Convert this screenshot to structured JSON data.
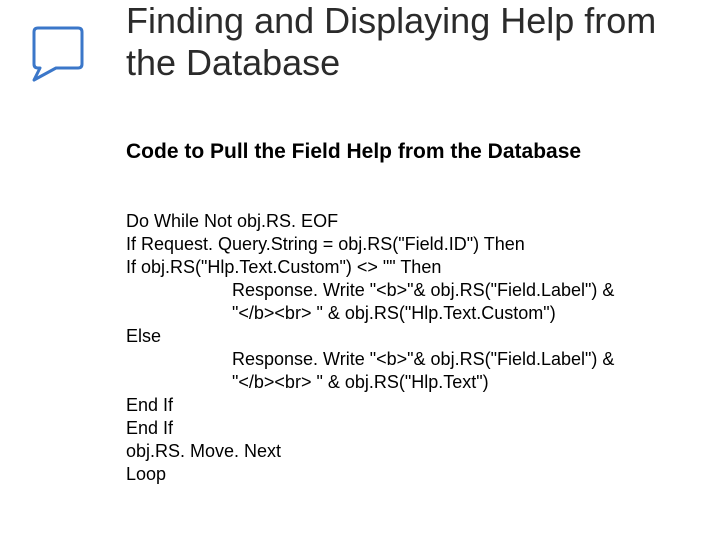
{
  "title": "Finding and Displaying Help from the Database",
  "subtitle": "Code to Pull the Field Help from the Database",
  "code": {
    "l1": "Do While Not obj.RS. EOF",
    "l2": "If Request. Query.String = obj.RS(\"Field.ID\") Then",
    "l3": "If obj.RS(\"Hlp.Text.Custom\") <> \"\" Then",
    "l4a": "Response. Write \"<b>\"& obj.RS(\"Field.Label\") &",
    "l4b": "\"</b><br> \" & obj.RS(\"Hlp.Text.Custom\")",
    "l5": "Else",
    "l6a": "Response. Write \"<b>\"& obj.RS(\"Field.Label\") &",
    "l6b": "\"</b><br> \" & obj.RS(\"Hlp.Text\")",
    "l7": "End If",
    "l8": "End If",
    "l9": "obj.RS. Move. Next",
    "l10": "Loop"
  },
  "icon": "note-icon"
}
